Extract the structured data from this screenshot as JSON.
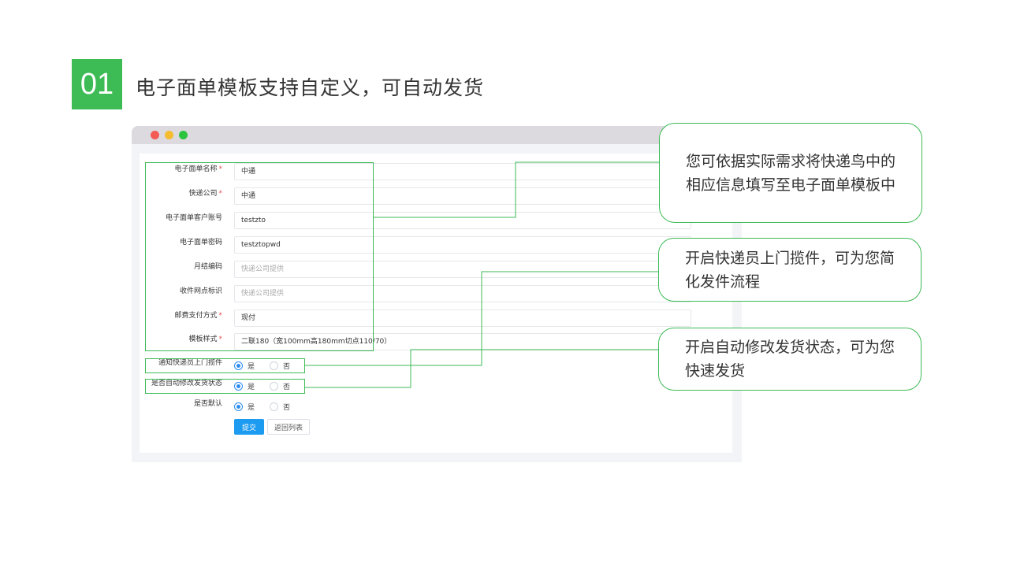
{
  "slide": {
    "number": "01",
    "title": "电子面单模板支持自定义，可自动发货",
    "accent_color": "#3dbb55"
  },
  "form": {
    "fields": [
      {
        "label": "电子面单名称",
        "required": true,
        "value": "中通",
        "placeholder": ""
      },
      {
        "label": "快递公司",
        "required": true,
        "value": "中通",
        "placeholder": ""
      },
      {
        "label": "电子面单客户账号",
        "required": false,
        "value": "testzto",
        "placeholder": ""
      },
      {
        "label": "电子面单密码",
        "required": false,
        "value": "testztopwd",
        "placeholder": ""
      },
      {
        "label": "月结编码",
        "required": false,
        "value": "",
        "placeholder": "快递公司提供"
      },
      {
        "label": "收件网点标识",
        "required": false,
        "value": "",
        "placeholder": "快递公司提供"
      },
      {
        "label": "邮费支付方式",
        "required": true,
        "value": "现付",
        "placeholder": ""
      },
      {
        "label": "模板样式",
        "required": true,
        "value": "二联180（宽100mm高180mm切点110/70）",
        "placeholder": ""
      }
    ],
    "radios": [
      {
        "label": "通知快递员上门揽件",
        "yes": "是",
        "no": "否",
        "selected": "是"
      },
      {
        "label": "是否自动修改发货状态",
        "yes": "是",
        "no": "否",
        "selected": "是"
      },
      {
        "label": "是否默认",
        "yes": "是",
        "no": "否",
        "selected": "是"
      }
    ],
    "submit_label": "提交",
    "back_label": "返回列表",
    "required_mark": "*"
  },
  "callouts": [
    {
      "text": "您可依据实际需求将快递鸟中的相应信息填写至电子面单模板中"
    },
    {
      "text": "开启快递员上门揽件，可为您简化发件流程"
    },
    {
      "text": "开启自动修改发货状态，可为您快速发货"
    }
  ]
}
